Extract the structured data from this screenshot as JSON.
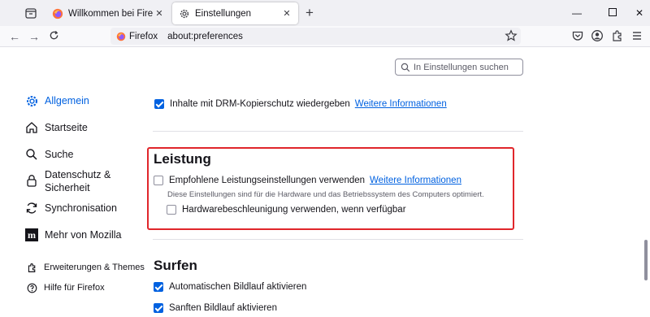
{
  "tabs": [
    {
      "label": "Willkommen bei Firefox",
      "active": false
    },
    {
      "label": "Einstellungen",
      "active": true
    }
  ],
  "urlbar": {
    "identity": "Firefox",
    "url": "about:preferences"
  },
  "search": {
    "placeholder": "In Einstellungen suchen"
  },
  "sidebar": {
    "items": [
      {
        "label": "Allgemein",
        "icon": "gear-icon",
        "active": true
      },
      {
        "label": "Startseite",
        "icon": "home-icon"
      },
      {
        "label": "Suche",
        "icon": "search-icon"
      },
      {
        "label": "Datenschutz & Sicherheit",
        "icon": "lock-icon"
      },
      {
        "label": "Synchronisation",
        "icon": "sync-icon"
      },
      {
        "label": "Mehr von Mozilla",
        "icon": "mozilla-icon"
      }
    ],
    "footer": [
      {
        "label": "Erweiterungen & Themes",
        "icon": "puzzle-icon"
      },
      {
        "label": "Hilfe für Firefox",
        "icon": "help-icon"
      }
    ]
  },
  "drm": {
    "label": "Inhalte mit DRM-Kopierschutz wiedergeben",
    "checked": true,
    "link": "Weitere Informationen"
  },
  "performance": {
    "heading": "Leistung",
    "recommended_label": "Empfohlene Leistungseinstellungen verwenden",
    "recommended_checked": false,
    "recommended_link": "Weitere Informationen",
    "description": "Diese Einstellungen sind für die Hardware und das Betriebssystem des Computers optimiert.",
    "hw_label": "Hardwarebeschleunigung verwenden, wenn verfügbar",
    "hw_checked": false
  },
  "browsing": {
    "heading": "Surfen",
    "autoscroll_label": "Automatischen Bildlauf aktivieren",
    "autoscroll_checked": true,
    "smooth_label": "Sanften Bildlauf aktivieren",
    "smooth_checked": true
  },
  "colors": {
    "accent": "#0061e0",
    "highlight": "#e0262b"
  }
}
